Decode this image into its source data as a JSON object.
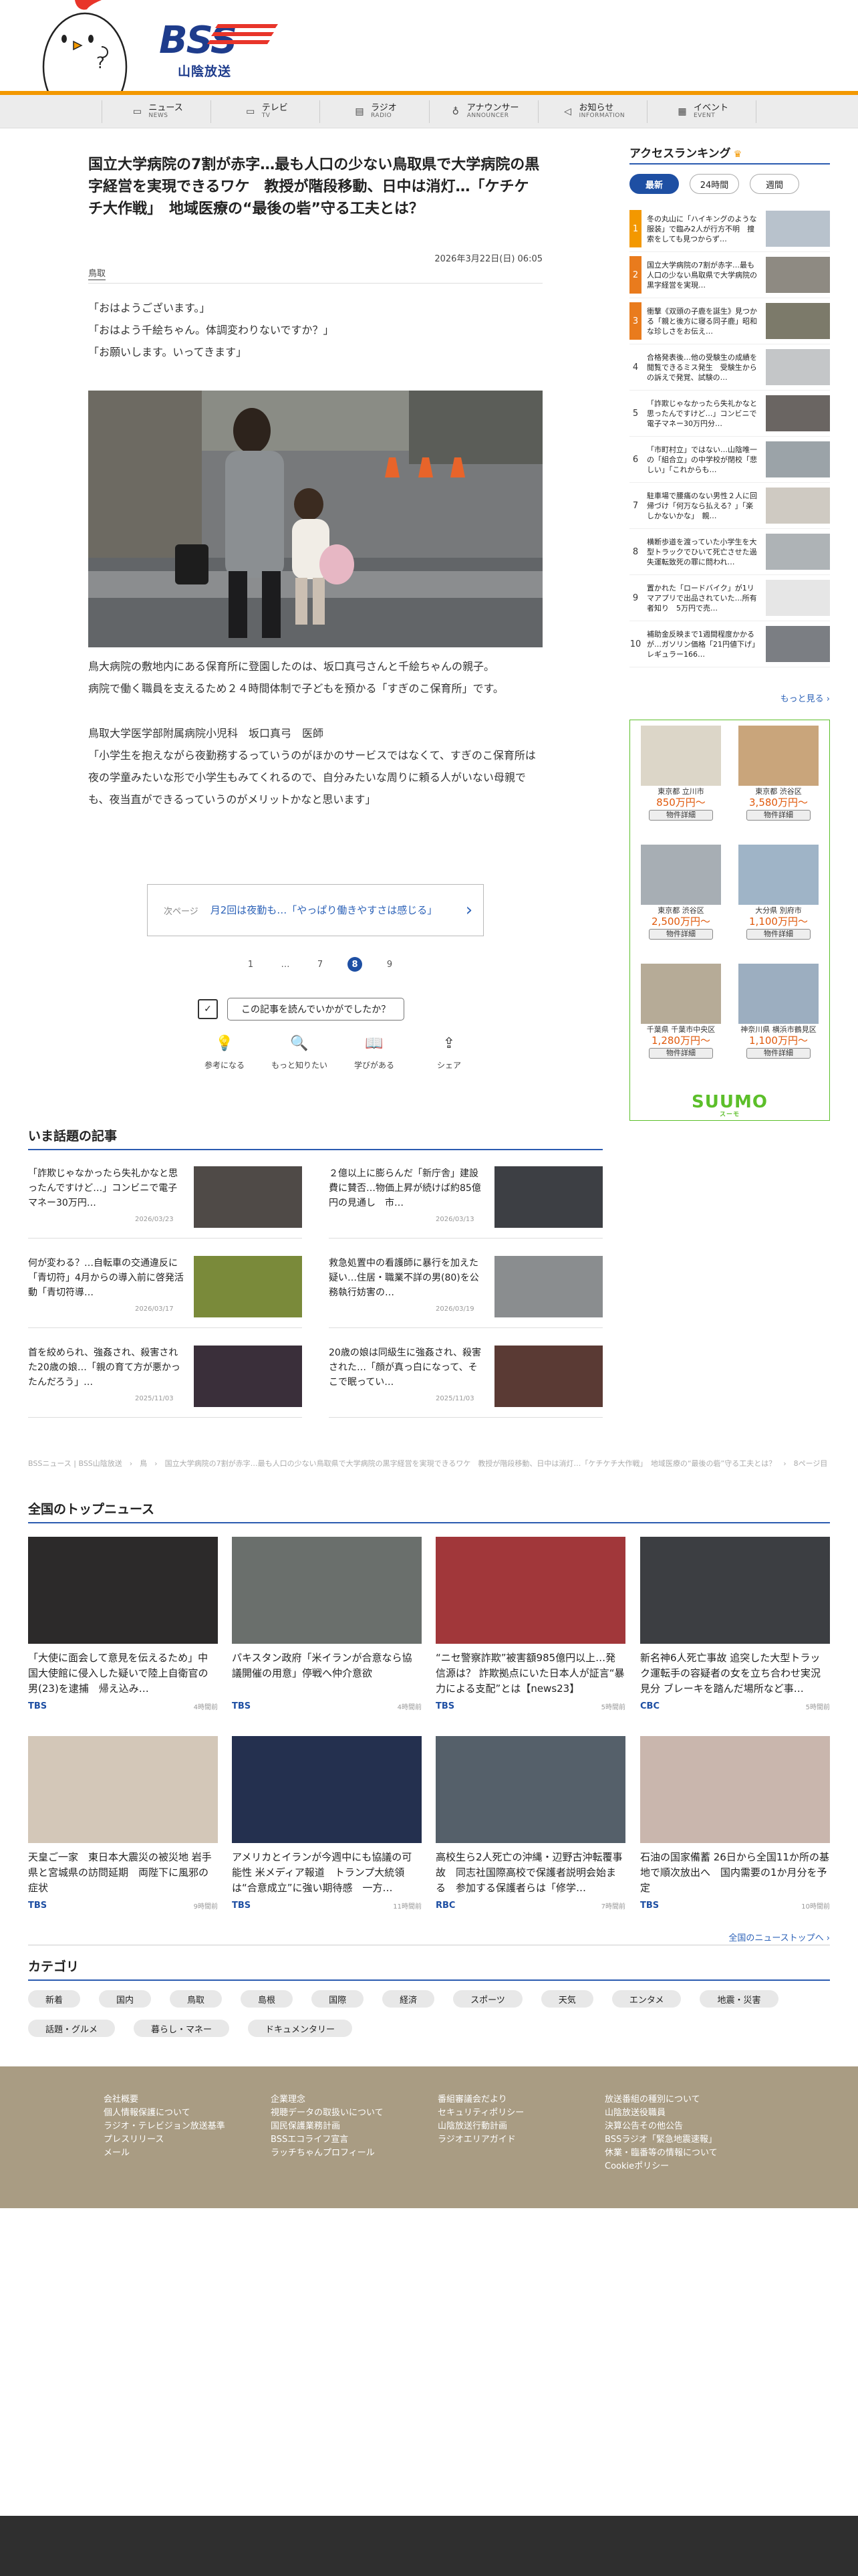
{
  "header": {
    "logo_text": "BSS",
    "logo_sub": "山陰放送"
  },
  "nav": [
    {
      "ja": "ニュース",
      "en": "NEWS",
      "icon": "tv-news-icon"
    },
    {
      "ja": "テレビ",
      "en": "TV",
      "icon": "tv-icon"
    },
    {
      "ja": "ラジオ",
      "en": "RADIO",
      "icon": "radio-icon"
    },
    {
      "ja": "アナウンサー",
      "en": "ANNOUNCER",
      "icon": "microphone-icon"
    },
    {
      "ja": "お知らせ",
      "en": "INFORMATION",
      "icon": "megaphone-icon"
    },
    {
      "ja": "イベント",
      "en": "EVENT",
      "icon": "calendar-icon"
    }
  ],
  "article": {
    "title": "国立大学病院の7割が赤字…最も人口の少ない鳥取県で大学病院の黒字経営を実現できるワケ　教授が階段移動、日中は消灯…「ケチケチ大作戦」　地域医療の“最後の砦”守る工夫とは？",
    "date": "2026年3月22日(日) 06:05",
    "tag": "鳥取",
    "para1": [
      "「おはようございます。」",
      "「おはよう千絵ちゃん。体調変わりないですか？」",
      "「お願いします。いってきます」"
    ],
    "para2": [
      "鳥大病院の敷地内にある保育所に登園したのは、坂口真弓さんと千絵ちゃんの親子。",
      "病院で働く職員を支えるため２４時間体制で子どもを預かる「すぎのこ保育所」です。"
    ],
    "para3": [
      "鳥取大学医学部附属病院小児科　坂口真弓　医師",
      "「小学生を抱えながら夜勤務するっていうのがほかのサービスではなくて、すぎのこ保育所は夜の学童みたいな形で小学生もみてくれるので、自分みたいな周りに頼る人がいない母親でも、夜当直ができるっていうのがメリットかなと思います」"
    ],
    "next_label": "次ページ",
    "next_text": "月2回は夜勤も…「やっぱり働きやすさは感じる」",
    "pager": [
      "1",
      "…",
      "7",
      "8",
      "9"
    ],
    "pager_current": "8",
    "survey_label": "この記事を読んでいかがでしたか？",
    "reactions": [
      "参考になる",
      "もっと知りたい",
      "学びがある",
      "シェア"
    ]
  },
  "ranking": {
    "title": "アクセスランキング",
    "tabs": [
      "最新",
      "24時間",
      "週間"
    ],
    "active_tab": "最新",
    "items": [
      {
        "rank": "1",
        "text": "冬の丸山に「ハイキングのような服装」で臨み2人が行方不明　捜索をしても見つからず…"
      },
      {
        "rank": "2",
        "text": "国立大学病院の7割が赤字…最も人口の少ない鳥取県で大学病院の黒字経営を実現…"
      },
      {
        "rank": "3",
        "text": "衝撃《双頭の子鹿を誕生》見つかる「親と後方に寝る同子鹿」昭和な珍しさをお伝え…"
      },
      {
        "rank": "4",
        "text": "合格発表後…他の受験生の成績を閲覧できるミス発生　受験生からの訴えで発覚、試験の…"
      },
      {
        "rank": "5",
        "text": "「詐欺じゃなかったら失礼かなと思ったんですけど…」コンビニで電子マネー30万円分…"
      },
      {
        "rank": "6",
        "text": "「市町村立」ではない…山陰唯一の「組合立」の中学校が閉校「悲しい」「これからも…"
      },
      {
        "rank": "7",
        "text": "駐車場で腰痛のない男性２人に回帰づけ「何万なら払える？」「楽しかないかな」　親…"
      },
      {
        "rank": "8",
        "text": "横断歩道を渡っていた小学生を大型トラックでひいて死亡させた過失運転致死の罪に問われ…"
      },
      {
        "rank": "9",
        "text": "置かれた「ロードバイク」が1リマアプリで出品されていた…所有者知り　5万円で売…"
      },
      {
        "rank": "10",
        "text": "補助金反映まで1週間程度かかるが…ガソリン価格「21円値下げ」　レギュラー166…"
      }
    ],
    "more": "もっと見る ›"
  },
  "suumo": {
    "cells": [
      {
        "loc": "東京都 立川市",
        "price": "850万円～",
        "btn": "物件詳細"
      },
      {
        "loc": "東京都 渋谷区",
        "price": "3,580万円～",
        "btn": "物件詳細"
      },
      {
        "loc": "東京都 渋谷区",
        "price": "2,500万円～",
        "btn": "物件詳細"
      },
      {
        "loc": "大分県 別府市",
        "price": "1,100万円～",
        "btn": "物件詳細"
      },
      {
        "loc": "千葉県 千葉市中央区",
        "price": "1,280万円～",
        "btn": "物件詳細"
      },
      {
        "loc": "神奈川県 横浜市鶴見区",
        "price": "1,100万円～",
        "btn": "物件詳細"
      }
    ],
    "logo": "SUUMO",
    "logo_sub": "スーモ"
  },
  "trending": {
    "title": "いま話題の記事",
    "items": [
      {
        "text": "「詐欺じゃなかったら失礼かなと思ったんですけど…」コンビニで電子マネー30万円…",
        "date": "2026/03/23"
      },
      {
        "text": "２億以上に膨らんだ「新庁舎」建設費に賛否…物価上昇が続けば約85億円の見通し　市…",
        "date": "2026/03/13"
      },
      {
        "text": "何が変わる？…自転車の交通違反に「青切符」4月からの導入前に啓発活動「青切符導…",
        "date": "2026/03/17"
      },
      {
        "text": "救急処置中の看護師に暴行を加えた疑い…住居・職業不詳の男(80)を公務執行妨害の…",
        "date": "2026/03/19"
      },
      {
        "text": "首を絞められ、強姦され、殺害された20歳の娘…「親の育て方が悪かったんだろう」…",
        "date": "2025/11/03"
      },
      {
        "text": "20歳の娘は同級生に強姦され、殺害された…「顔が真っ白になって、そこで眠ってい…",
        "date": "2025/11/03"
      }
    ]
  },
  "breadcrumb": "BSSニュース | BSS山陰放送　›　鳥　›　国立大学病院の7割が赤字…最も人口の少ない鳥取県で大学病院の黒字経営を実現できるワケ　教授が階段移動、日中は消灯…「ケチケチ大作戦」　地域医療の“最後の砦”守る工夫とは？　›　8ページ目",
  "national": {
    "title": "全国のトップニュース",
    "items": [
      {
        "text": "「大使に面会して意見を伝えるため」中国大使館に侵入した疑いで陸上自衛官の男(23)を逮捕　帰え込み…",
        "source": "TBS",
        "date": "4時間前"
      },
      {
        "text": "パキスタン政府「米イランが合意なら協議開催の用意」停戦へ仲介意欲",
        "source": "TBS",
        "date": "4時間前"
      },
      {
        "text": "“ニセ警察詐欺”被害額985億円以上…発信源は？ 詐欺拠点にいた日本人が証言“暴力による支配”とは【news23】",
        "source": "TBS",
        "date": "5時間前"
      },
      {
        "text": "新名神6人死亡事故 追突した大型トラック運転手の容疑者の女を立ち合わせ実況見分 ブレーキを踏んだ場所など事…",
        "source": "CBC",
        "date": "5時間前"
      },
      {
        "text": "天皇ご一家　東日本大震災の被災地 岩手県と宮城県の訪問延期　両陛下に風邪の症状",
        "source": "TBS",
        "date": "9時間前"
      },
      {
        "text": "アメリカとイランが今週中にも協議の可能性 米メディア報道　トランプ大統領は“合意成立”に強い期待感　一方…",
        "source": "TBS",
        "date": "11時間前"
      },
      {
        "text": "高校生ら2人死亡の沖縄・辺野古沖転覆事故　同志社国際高校で保護者説明会始まる　参加する保護者らは「修学…",
        "source": "RBC",
        "date": "7時間前"
      },
      {
        "text": "石油の国家備蓄 26日から全国11か所の基地で順次放出へ　国内需要の1か月分を予定",
        "source": "TBS",
        "date": "10時間前"
      }
    ],
    "more": "全国のニューストップへ ›"
  },
  "categories": {
    "title": "カテゴリ",
    "items": [
      "新着",
      "国内",
      "鳥取",
      "島根",
      "国際",
      "経済",
      "スポーツ",
      "天気",
      "エンタメ",
      "地震・災害",
      "話題・グルメ",
      "暮らし・マネー",
      "ドキュメンタリー"
    ]
  },
  "footer": {
    "col1": [
      "会社概要",
      "個人情報保護について",
      "ラジオ・テレビジョン放送基準",
      "プレスリリース",
      "メール"
    ],
    "col2": [
      "企業理念",
      "視聴データの取扱いについて",
      "国民保護業務計画",
      "BSSエコライフ宣言",
      "ラッチちゃんプロフィール"
    ],
    "col3": [
      "番組審議会だより",
      "セキュリティポリシー",
      "山陰放送行動計画",
      "ラジオエリアガイド"
    ],
    "col4": [
      "放送番組の種別について",
      "山陰放送役職員",
      "決算公告その他公告",
      "BSSラジオ「緊急地震速報」",
      "休業・臨番等の情報について",
      "Cookieポリシー"
    ]
  }
}
